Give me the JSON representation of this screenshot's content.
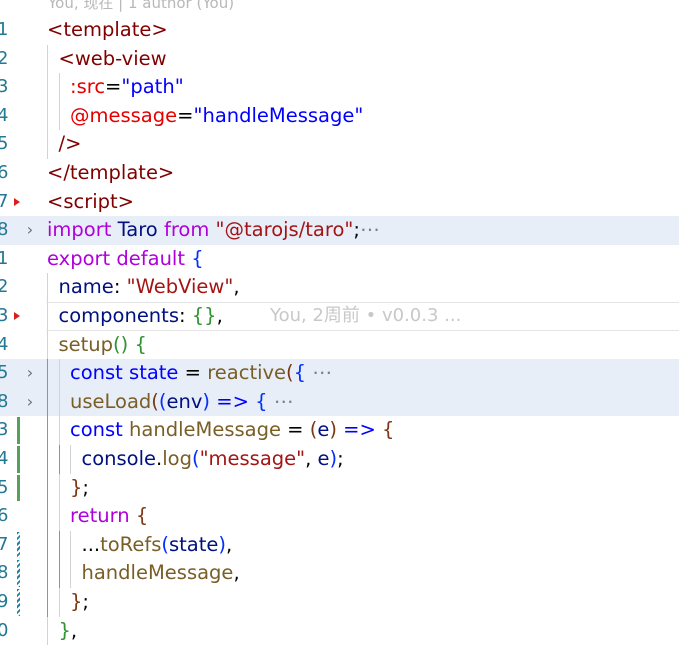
{
  "blame_header": "You, 现在 | 1 author (You)",
  "inline_blame": "You, 2周前 • v0.0.3 ...",
  "lines": [
    {
      "num": "1",
      "code": [
        {
          "t": "<template>",
          "c": "t-tag"
        }
      ]
    },
    {
      "num": "2",
      "code": [
        {
          "t": "<web-view",
          "c": "t-tag"
        }
      ]
    },
    {
      "num": "3",
      "code": [
        {
          "t": ":src",
          "c": "t-attr"
        },
        {
          "t": "=",
          "c": "t-plain"
        },
        {
          "t": "\"path\"",
          "c": "t-blue"
        }
      ]
    },
    {
      "num": "4",
      "code": [
        {
          "t": "@message",
          "c": "t-attr"
        },
        {
          "t": "=",
          "c": "t-plain"
        },
        {
          "t": "\"handleMessage\"",
          "c": "t-blue"
        }
      ]
    },
    {
      "num": "5",
      "code": [
        {
          "t": "/>",
          "c": "t-tag"
        }
      ]
    },
    {
      "num": "6",
      "code": [
        {
          "t": "</template>",
          "c": "t-tag"
        }
      ]
    },
    {
      "num": "7",
      "code": [
        {
          "t": "<script>",
          "c": "t-tag"
        }
      ]
    },
    {
      "num": "8",
      "code": [
        {
          "t": "import",
          "c": "t-kw"
        },
        {
          "t": " Taro ",
          "c": "t-var"
        },
        {
          "t": "from",
          "c": "t-kw"
        },
        {
          "t": " ",
          "c": "t-plain"
        },
        {
          "t": "\"@tarojs/taro\"",
          "c": "t-str"
        },
        {
          "t": ";",
          "c": "t-plain"
        },
        {
          "t": "⋯",
          "c": "t-ell"
        }
      ]
    },
    {
      "num": "1",
      "code": [
        {
          "t": "export",
          "c": "t-kw"
        },
        {
          "t": " ",
          "c": "t-plain"
        },
        {
          "t": "default",
          "c": "t-kw"
        },
        {
          "t": " ",
          "c": "t-plain"
        },
        {
          "t": "{",
          "c": "t-br1"
        }
      ]
    },
    {
      "num": "2",
      "code": [
        {
          "t": "name",
          "c": "t-var"
        },
        {
          "t": ": ",
          "c": "t-plain"
        },
        {
          "t": "\"WebView\"",
          "c": "t-str"
        },
        {
          "t": ",",
          "c": "t-plain"
        }
      ]
    },
    {
      "num": "3",
      "code": [
        {
          "t": "components",
          "c": "t-var"
        },
        {
          "t": ": ",
          "c": "t-plain"
        },
        {
          "t": "{}",
          "c": "t-br2"
        },
        {
          "t": ",",
          "c": "t-plain"
        }
      ]
    },
    {
      "num": "4",
      "code": [
        {
          "t": "setup",
          "c": "t-fn"
        },
        {
          "t": "()",
          "c": "t-br2"
        },
        {
          "t": " ",
          "c": "t-plain"
        },
        {
          "t": "{",
          "c": "t-br2"
        }
      ]
    },
    {
      "num": "5",
      "code": [
        {
          "t": "const",
          "c": "t-blue"
        },
        {
          "t": " ",
          "c": "t-plain"
        },
        {
          "t": "state",
          "c": "t-blue"
        },
        {
          "t": " = ",
          "c": "t-plain"
        },
        {
          "t": "reactive",
          "c": "t-fn"
        },
        {
          "t": "(",
          "c": "t-br3"
        },
        {
          "t": "{",
          "c": "t-br1"
        },
        {
          "t": " ⋯",
          "c": "t-ell"
        }
      ]
    },
    {
      "num": "8",
      "code": [
        {
          "t": "useLoad",
          "c": "t-fn"
        },
        {
          "t": "(",
          "c": "t-br3"
        },
        {
          "t": "(",
          "c": "t-br1"
        },
        {
          "t": "env",
          "c": "t-var"
        },
        {
          "t": ")",
          "c": "t-br1"
        },
        {
          "t": " ",
          "c": "t-plain"
        },
        {
          "t": "=>",
          "c": "t-blue"
        },
        {
          "t": " ",
          "c": "t-plain"
        },
        {
          "t": "{",
          "c": "t-br1"
        },
        {
          "t": " ⋯",
          "c": "t-ell"
        }
      ]
    },
    {
      "num": "3",
      "code": [
        {
          "t": "const",
          "c": "t-blue"
        },
        {
          "t": " ",
          "c": "t-plain"
        },
        {
          "t": "handleMessage",
          "c": "t-fn"
        },
        {
          "t": " = ",
          "c": "t-plain"
        },
        {
          "t": "(",
          "c": "t-br3"
        },
        {
          "t": "e",
          "c": "t-var"
        },
        {
          "t": ")",
          "c": "t-br3"
        },
        {
          "t": " ",
          "c": "t-plain"
        },
        {
          "t": "=>",
          "c": "t-blue"
        },
        {
          "t": " ",
          "c": "t-plain"
        },
        {
          "t": "{",
          "c": "t-br3"
        }
      ]
    },
    {
      "num": "4",
      "code": [
        {
          "t": "console",
          "c": "t-var"
        },
        {
          "t": ".",
          "c": "t-plain"
        },
        {
          "t": "log",
          "c": "t-fn"
        },
        {
          "t": "(",
          "c": "t-br1"
        },
        {
          "t": "\"message\"",
          "c": "t-str"
        },
        {
          "t": ", ",
          "c": "t-plain"
        },
        {
          "t": "e",
          "c": "t-var"
        },
        {
          "t": ")",
          "c": "t-br1"
        },
        {
          "t": ";",
          "c": "t-plain"
        }
      ]
    },
    {
      "num": "5",
      "code": [
        {
          "t": "}",
          "c": "t-br3"
        },
        {
          "t": ";",
          "c": "t-plain"
        }
      ]
    },
    {
      "num": "6",
      "code": [
        {
          "t": "return",
          "c": "t-kw"
        },
        {
          "t": " ",
          "c": "t-plain"
        },
        {
          "t": "{",
          "c": "t-br3"
        }
      ]
    },
    {
      "num": "7",
      "code": [
        {
          "t": "...",
          "c": "t-plain"
        },
        {
          "t": "toRefs",
          "c": "t-fn"
        },
        {
          "t": "(",
          "c": "t-br1"
        },
        {
          "t": "state",
          "c": "t-var"
        },
        {
          "t": ")",
          "c": "t-br1"
        },
        {
          "t": ",",
          "c": "t-plain"
        }
      ]
    },
    {
      "num": "8",
      "code": [
        {
          "t": "handleMessage",
          "c": "t-fn"
        },
        {
          "t": ",",
          "c": "t-plain"
        }
      ]
    },
    {
      "num": "9",
      "code": [
        {
          "t": "}",
          "c": "t-br3"
        },
        {
          "t": ";",
          "c": "t-plain"
        }
      ]
    },
    {
      "num": "0",
      "code": [
        {
          "t": "}",
          "c": "t-br2"
        },
        {
          "t": ",",
          "c": "t-plain"
        }
      ]
    }
  ]
}
